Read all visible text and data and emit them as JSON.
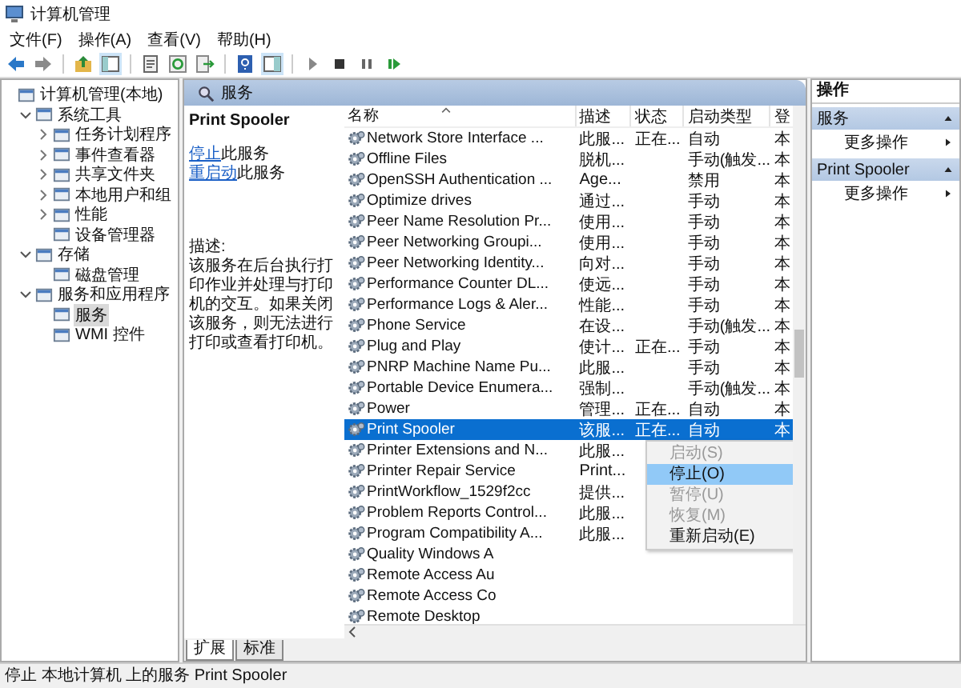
{
  "window": {
    "title": "计算机管理"
  },
  "menu_bar": [
    "文件(F)",
    "操作(A)",
    "查看(V)",
    "帮助(H)"
  ],
  "tree": [
    {
      "label": "计算机管理(本地)",
      "selected": false,
      "children": [
        {
          "label": "系统工具",
          "expanded": true,
          "selected": false,
          "children": [
            {
              "label": "任务计划程序",
              "expanded": false,
              "selected": false
            },
            {
              "label": "事件查看器",
              "expanded": false,
              "selected": false
            },
            {
              "label": "共享文件夹",
              "expanded": false,
              "selected": false
            },
            {
              "label": "本地用户和组",
              "expanded": false,
              "selected": false
            },
            {
              "label": "性能",
              "expanded": false,
              "selected": false
            },
            {
              "label": "设备管理器",
              "selected": false
            }
          ]
        },
        {
          "label": "存储",
          "expanded": true,
          "selected": false,
          "children": [
            {
              "label": "磁盘管理",
              "selected": false
            }
          ]
        },
        {
          "label": "服务和应用程序",
          "expanded": true,
          "selected": false,
          "children": [
            {
              "label": "服务",
              "selected": true
            },
            {
              "label": "WMI 控件",
              "selected": false
            }
          ]
        }
      ]
    }
  ],
  "panel_title": "服务",
  "detail": {
    "title": "Print Spooler",
    "actions": [
      {
        "link": "停止",
        "text": "此服务"
      },
      {
        "link": "重启动",
        "text": "此服务"
      }
    ],
    "description_label": "描述:",
    "description": "该服务在后台执行打印作业并处理与打印机的交互。如果关闭该服务，则无法进行打印或查看打印机。"
  },
  "table": {
    "columns": [
      "名称",
      "描述",
      "状态",
      "启动类型",
      "登"
    ],
    "rows": [
      {
        "name": "Network Store Interface ...",
        "description": "此服...",
        "status": "正在...",
        "startup": "自动",
        "logon": "本",
        "selected": false
      },
      {
        "name": "Offline Files",
        "description": "脱机...",
        "startup": "手动(触发...",
        "logon": "本",
        "selected": false
      },
      {
        "name": "OpenSSH Authentication ...",
        "description": "Age...",
        "startup": "禁用",
        "logon": "本",
        "selected": false
      },
      {
        "name": "Optimize drives",
        "description": "通过...",
        "startup": "手动",
        "logon": "本",
        "selected": false
      },
      {
        "name": "Peer Name Resolution Pr...",
        "description": "使用...",
        "startup": "手动",
        "logon": "本",
        "selected": false
      },
      {
        "name": "Peer Networking Groupi...",
        "description": "使用...",
        "startup": "手动",
        "logon": "本",
        "selected": false
      },
      {
        "name": "Peer Networking Identity...",
        "description": "向对...",
        "startup": "手动",
        "logon": "本",
        "selected": false
      },
      {
        "name": "Performance Counter DL...",
        "description": "使远...",
        "startup": "手动",
        "logon": "本",
        "selected": false
      },
      {
        "name": "Performance Logs & Aler...",
        "description": "性能...",
        "startup": "手动",
        "logon": "本",
        "selected": false
      },
      {
        "name": "Phone Service",
        "description": "在设...",
        "startup": "手动(触发...",
        "logon": "本",
        "selected": false
      },
      {
        "name": "Plug and Play",
        "description": "使计...",
        "status": "正在...",
        "startup": "手动",
        "logon": "本",
        "selected": false
      },
      {
        "name": "PNRP Machine Name Pu...",
        "description": "此服...",
        "startup": "手动",
        "logon": "本",
        "selected": false
      },
      {
        "name": "Portable Device Enumera...",
        "description": "强制...",
        "startup": "手动(触发...",
        "logon": "本",
        "selected": false
      },
      {
        "name": "Power",
        "description": "管理...",
        "status": "正在...",
        "startup": "自动",
        "logon": "本",
        "selected": false
      },
      {
        "name": "Print Spooler",
        "description": "该服...",
        "status": "正在...",
        "startup": "自动",
        "logon": "本",
        "selected": true
      },
      {
        "name": "Printer Extensions and N...",
        "description": "此服...",
        "selected": false
      },
      {
        "name": "Printer Repair Service",
        "description": "Print...",
        "selected": false
      },
      {
        "name": "PrintWorkflow_1529f2cc",
        "description": "提供...",
        "selected": false
      },
      {
        "name": "Problem Reports Control...",
        "description": "此服...",
        "selected": false
      },
      {
        "name": "Program Compatibility A...",
        "description": "此服...",
        "selected": false
      },
      {
        "name": "Quality Windows A",
        "selected": false
      },
      {
        "name": "Remote Access Au",
        "selected": false
      },
      {
        "name": "Remote Access Co",
        "selected": false
      },
      {
        "name": "Remote Desktop",
        "selected": false
      }
    ]
  },
  "context_menu": [
    {
      "label": "启动(S)",
      "disabled": true,
      "selected": false
    },
    {
      "label": "停止(O)",
      "disabled": false,
      "selected": true
    },
    {
      "label": "暂停(U)",
      "disabled": true,
      "selected": false
    },
    {
      "label": "恢复(M)",
      "disabled": true,
      "selected": false
    },
    {
      "label": "重新启动(E)",
      "disabled": false,
      "selected": false
    }
  ],
  "bottom_tabs": [
    {
      "label": "扩展",
      "selected": true
    },
    {
      "label": "标准",
      "selected": false
    }
  ],
  "actions_pane": {
    "title": "操作",
    "sections": [
      {
        "title": "服务",
        "items": [
          "更多操作"
        ]
      },
      {
        "title": "Print Spooler",
        "items": [
          "更多操作"
        ]
      }
    ]
  },
  "status_bar": "停止 本地计算机 上的服务 Print Spooler"
}
